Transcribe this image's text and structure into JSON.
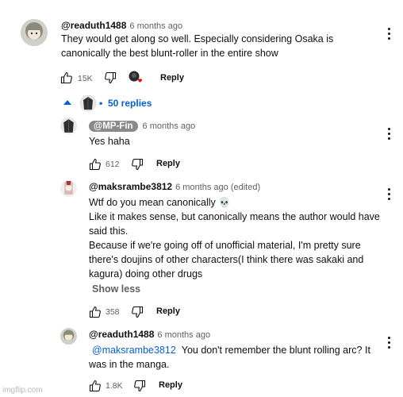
{
  "comment1": {
    "handle": "@readuth1488",
    "time": "6 months ago",
    "text_line1": "They would get along so well. Especially considering Osaka is",
    "text_line2": "canonically the best blunt-roller in the entire show",
    "likes": "15K",
    "reply_label": "Reply"
  },
  "replies_toggle": {
    "label": "50 replies",
    "separator": "•"
  },
  "reply1": {
    "handle": "@MP-Fin",
    "time": "6 months ago",
    "text": "Yes haha",
    "likes": "612",
    "reply_label": "Reply"
  },
  "reply2": {
    "handle": "@maksrambe3812",
    "time": "6 months ago (edited)",
    "line1": "Wtf do you mean canonically 💀",
    "line2": "Like it makes sense, but canonically means the author would have",
    "line3": "said this.",
    "line4": "Because if we're going off of unofficial material, I'm pretty sure",
    "line5": "there's doujins of other characters(I think there was sakaki and",
    "line6": "kagura) doing other drugs",
    "show_less": "Show less",
    "likes": "358",
    "reply_label": "Reply"
  },
  "reply3": {
    "handle": "@readuth1488",
    "time": "6 months ago",
    "mention": "@maksrambe3812",
    "line1_rest": "You don't remember the blunt rolling arc? It",
    "line2": "was in the manga.",
    "likes": "1.8K",
    "reply_label": "Reply"
  },
  "watermark": "imgflip.com",
  "colors": {
    "link": "#065fd4",
    "secondary": "#606060",
    "heart": "#ff0000"
  },
  "icons": [
    "thumb-up-icon",
    "thumb-down-icon",
    "creator-heart-icon",
    "caret-up-icon",
    "more-vert-icon"
  ]
}
